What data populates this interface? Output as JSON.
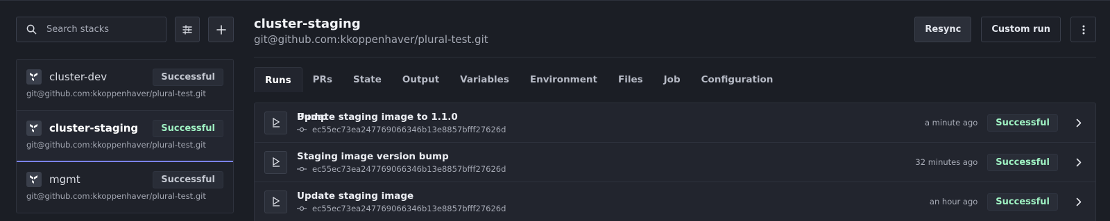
{
  "sidebar": {
    "search": {
      "placeholder": "Search stacks",
      "icon": "search-icon"
    },
    "filter_icon": "sliders-icon",
    "add_icon": "plus-icon",
    "stacks": [
      {
        "name": "cluster-dev",
        "status": "Successful",
        "repo": "git@github.com:kkoppenhaver/plural-test.git",
        "icon": "terraform-icon"
      },
      {
        "name": "cluster-staging",
        "status": "Successful",
        "repo": "git@github.com:kkoppenhaver/plural-test.git",
        "icon": "terraform-icon"
      },
      {
        "name": "mgmt",
        "status": "Successful",
        "repo": "git@github.com:kkoppenhaver/plural-test.git",
        "icon": "terraform-icon"
      }
    ]
  },
  "header": {
    "title": "cluster-staging",
    "subtitle": "git@github.com:kkoppenhaver/plural-test.git",
    "resync_label": "Resync",
    "custom_run_label": "Custom run",
    "menu_icon": "kebab-icon"
  },
  "tabs": [
    {
      "label": "Runs"
    },
    {
      "label": "PRs"
    },
    {
      "label": "State"
    },
    {
      "label": "Output"
    },
    {
      "label": "Variables"
    },
    {
      "label": "Environment"
    },
    {
      "label": "Files"
    },
    {
      "label": "Job"
    },
    {
      "label": "Configuration"
    }
  ],
  "runs": [
    {
      "message": "Update staging image to 1.1.0",
      "overlap_text": "Bump",
      "sha": "ec55ec73ea247769066346b13e8857bfff27626d",
      "time": "a minute ago",
      "status": "Successful"
    },
    {
      "message": "Staging image version bump",
      "sha": "ec55ec73ea247769066346b13e8857bfff27626d",
      "time": "32 minutes ago",
      "status": "Successful"
    },
    {
      "message": "Update staging image",
      "sha": "ec55ec73ea247769066346b13e8857bfff27626d",
      "time": "an hour ago",
      "status": "Successful"
    }
  ],
  "colors": {
    "accent": "#7b83f3",
    "success": "#9ff2c3",
    "background": "#1b1e25"
  }
}
